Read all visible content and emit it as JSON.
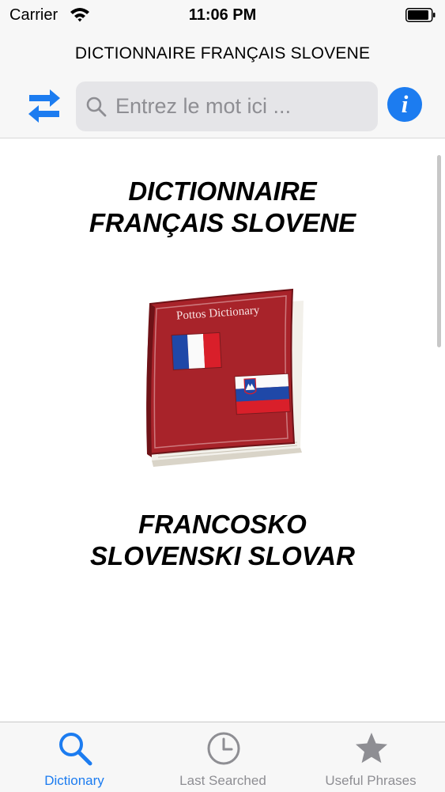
{
  "status_bar": {
    "carrier": "Carrier",
    "time": "11:06 PM"
  },
  "nav": {
    "title": "DICTIONNAIRE FRANÇAIS SLOVENE",
    "info_label": "i"
  },
  "search": {
    "placeholder": "Entrez le mot ici ...",
    "value": ""
  },
  "content": {
    "heading_top": [
      "DICTIONNAIRE",
      "FRANÇAIS SLOVENE"
    ],
    "heading_bottom": [
      "FRANCOSKO",
      "SLOVENSKI SLOVAR"
    ],
    "book_title": "Pottos Dictionary",
    "flags": [
      "france-flag",
      "slovenia-flag"
    ]
  },
  "tabs": [
    {
      "label": "Dictionary",
      "icon": "magnifier-icon",
      "active": true
    },
    {
      "label": "Last Searched",
      "icon": "clock-icon",
      "active": false
    },
    {
      "label": "Useful Phrases",
      "icon": "star-icon",
      "active": false
    }
  ],
  "colors": {
    "accent": "#1c7cf0",
    "inactive": "#8e8e93",
    "book": "#a5252a"
  }
}
